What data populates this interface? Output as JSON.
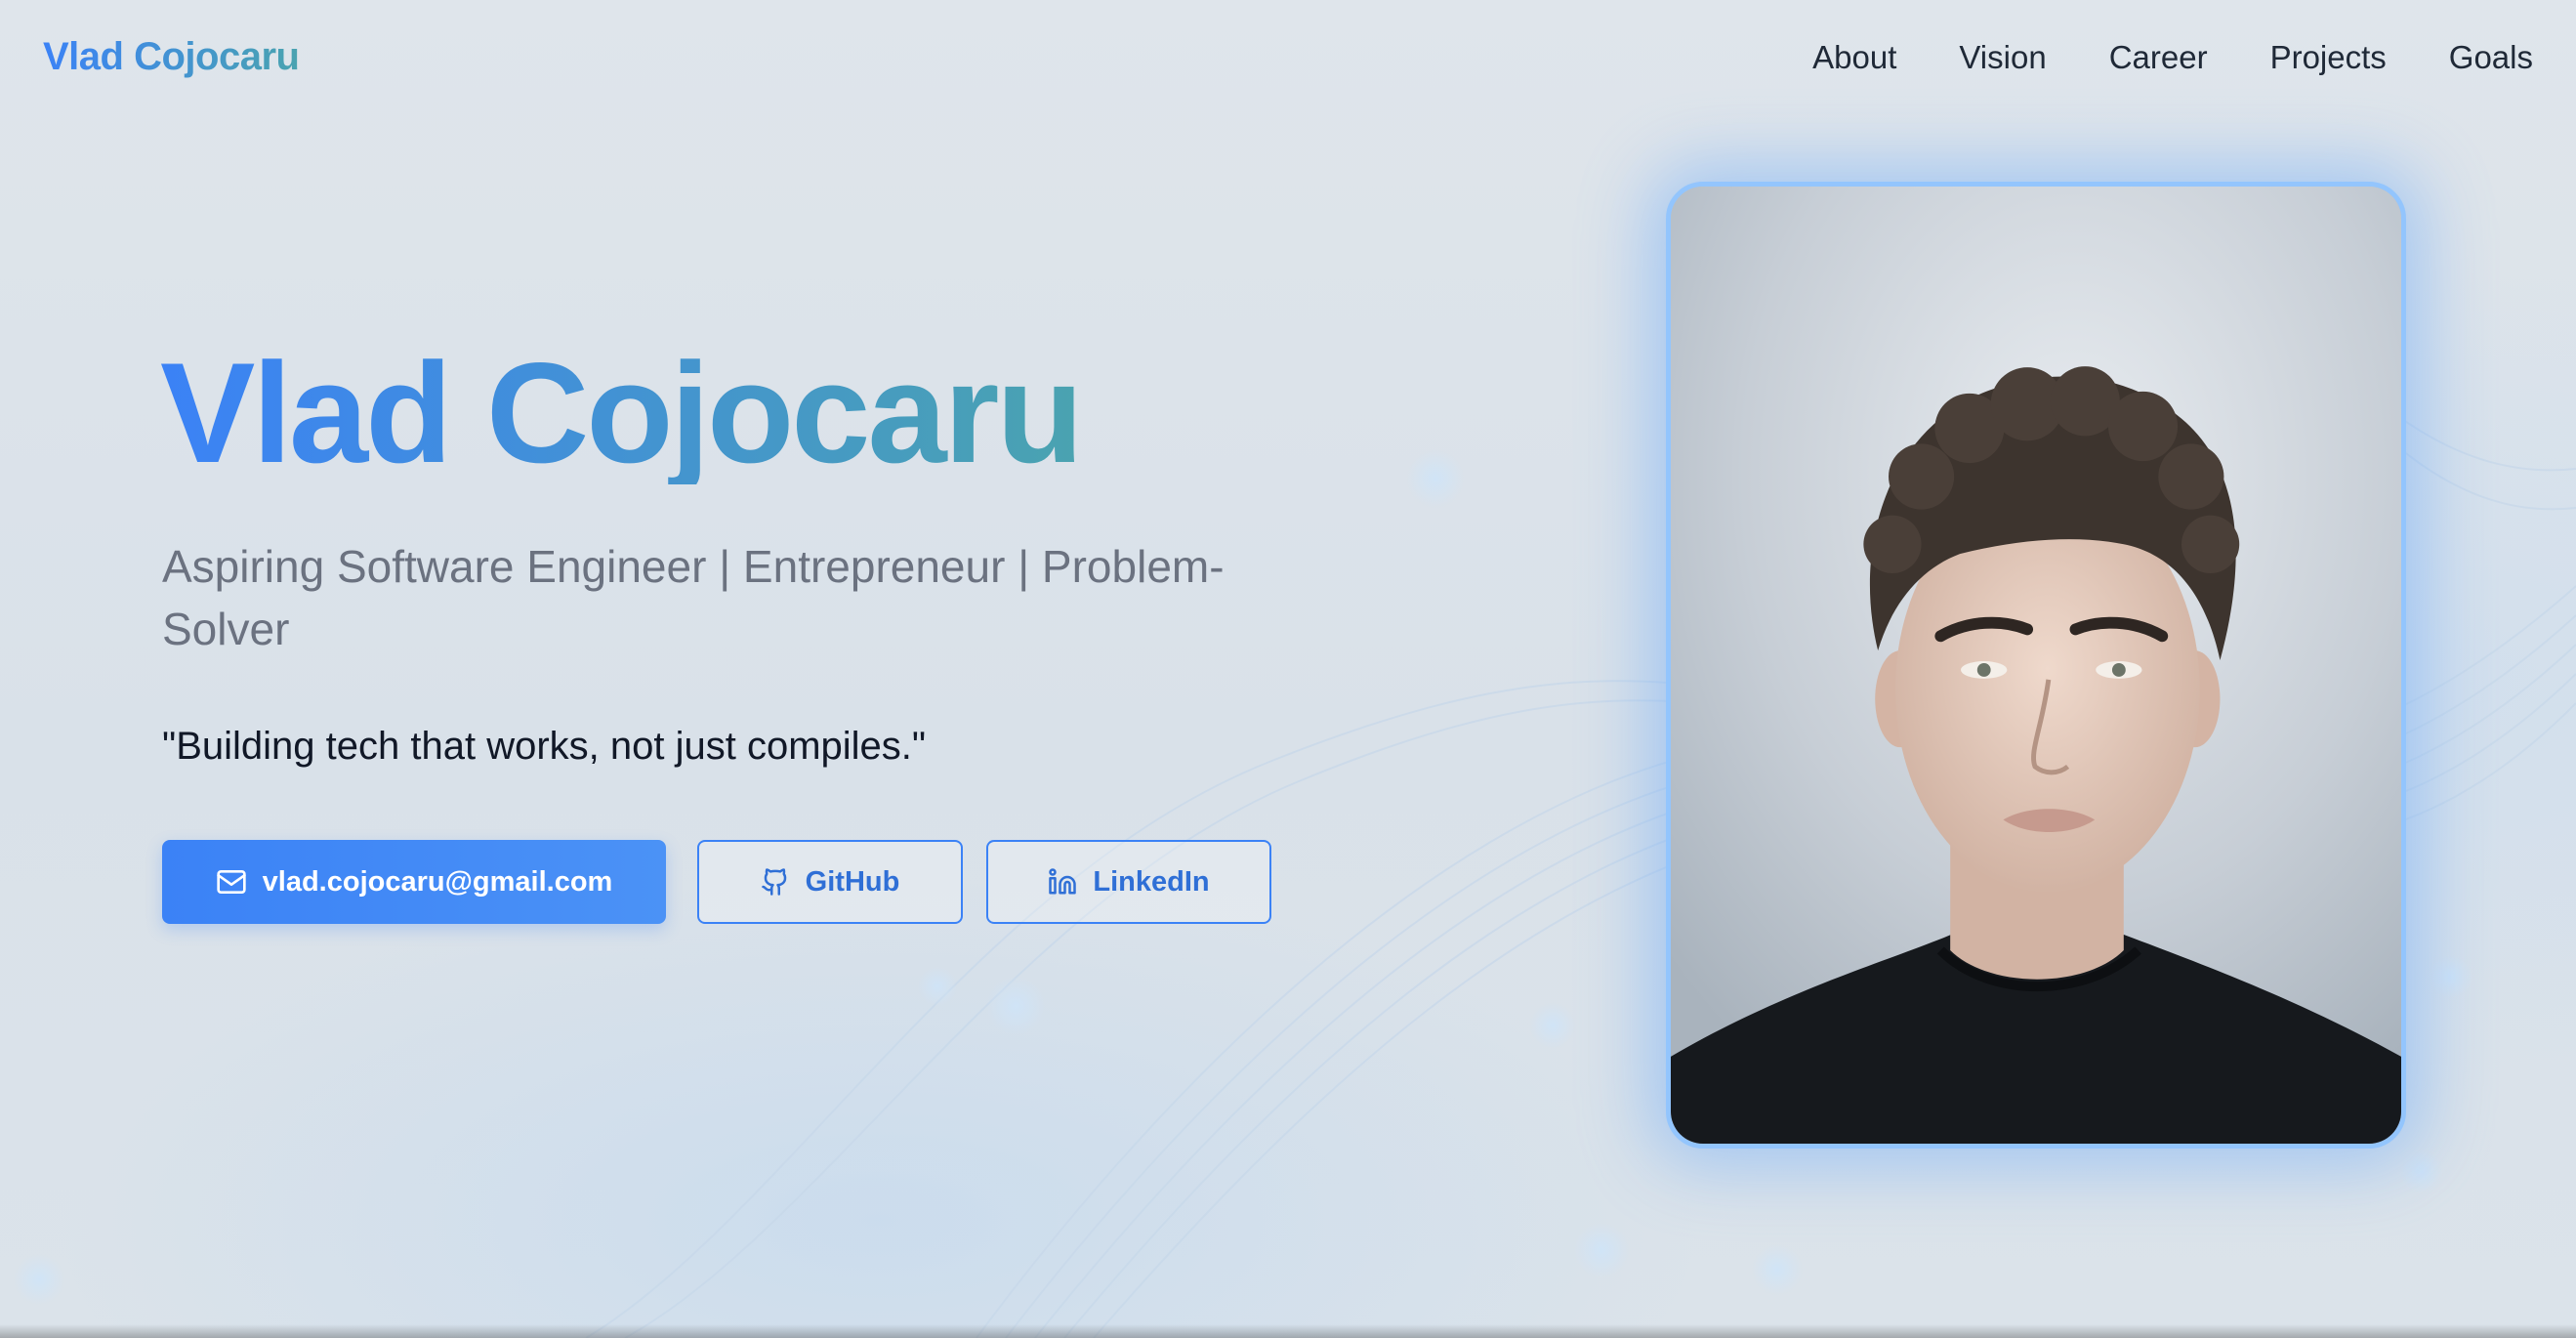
{
  "nav": {
    "brand": "Vlad Cojocaru",
    "links": [
      "About",
      "Vision",
      "Career",
      "Projects",
      "Goals"
    ]
  },
  "hero": {
    "title": "Vlad Cojocaru",
    "subtitle": "Aspiring Software Engineer | Entrepreneur | Problem-Solver",
    "quote": "\"Building tech that works, not just compiles.\"",
    "buttons": {
      "email": "vlad.cojocaru@gmail.com",
      "github": "GitHub",
      "linkedin": "LinkedIn"
    }
  },
  "icons": {
    "email": "mail-icon",
    "github": "github-icon",
    "linkedin": "linkedin-icon"
  },
  "colors": {
    "accent": "#3b82f6",
    "accent_gradient_end": "#4aa3b0",
    "background": "#dfe5eb",
    "text_primary": "#111827",
    "text_muted": "#6b7280"
  }
}
